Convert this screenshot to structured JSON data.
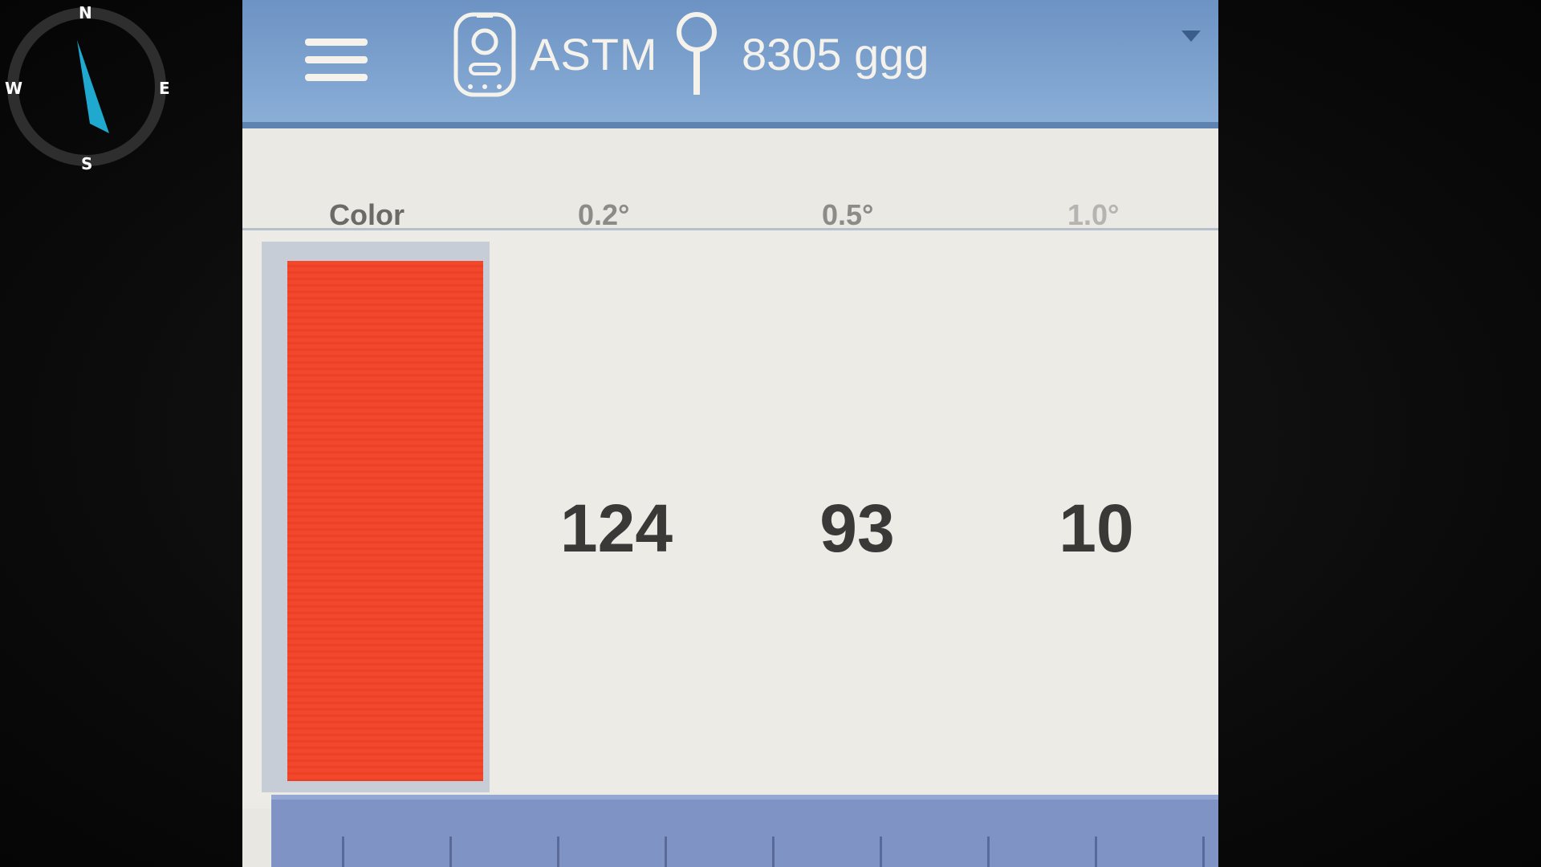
{
  "compass": {
    "north": "N",
    "south": "S",
    "west": "W",
    "east": "E",
    "needle_color": "#1fa9cf",
    "ring_color": "#2e2e2e"
  },
  "header": {
    "menu_icon": "hamburger-menu-icon",
    "device_icon": "device-icon",
    "standard": "ASTM",
    "pin_icon": "sample-pin-icon",
    "sample": "8305 ggg",
    "dropdown_icon": "dropdown-arrow-icon",
    "bar_color": "#7ea3cf"
  },
  "table": {
    "columns": [
      "Color",
      "0.2°",
      "0.5°",
      "1.0°"
    ],
    "rows": [
      {
        "swatch_color": "#f2472a",
        "values": [
          "124",
          "93",
          "10"
        ]
      }
    ]
  }
}
